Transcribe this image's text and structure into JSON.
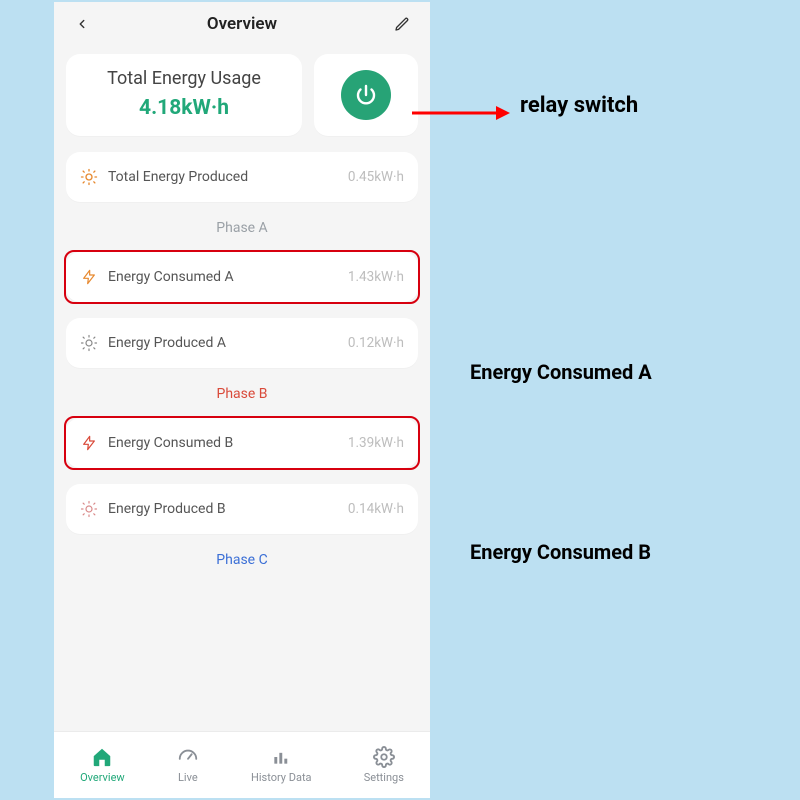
{
  "header": {
    "title": "Overview"
  },
  "total": {
    "title": "Total Energy Usage",
    "value": "4.18kW·h"
  },
  "produced_total": {
    "label": "Total Energy Produced",
    "value": "0.45kW·h"
  },
  "phaseA": {
    "header": "Phase A",
    "consumed": {
      "label": "Energy Consumed A",
      "value": "1.43kW·h"
    },
    "produced": {
      "label": "Energy Produced A",
      "value": "0.12kW·h"
    }
  },
  "phaseB": {
    "header": "Phase B",
    "consumed": {
      "label": "Energy Consumed B",
      "value": "1.39kW·h"
    },
    "produced": {
      "label": "Energy Produced B",
      "value": "0.14kW·h"
    }
  },
  "phaseC": {
    "header": "Phase C"
  },
  "tabs": {
    "overview": "Overview",
    "live": "Live",
    "history": "History Data",
    "settings": "Settings"
  },
  "annotations": {
    "relay": "relay switch",
    "consumedA": "Energy Consumed A",
    "consumedB": "Energy Consumed B"
  },
  "colors": {
    "accent": "#21a879",
    "orange": "#e7892f",
    "redbox": "#d7000f"
  }
}
